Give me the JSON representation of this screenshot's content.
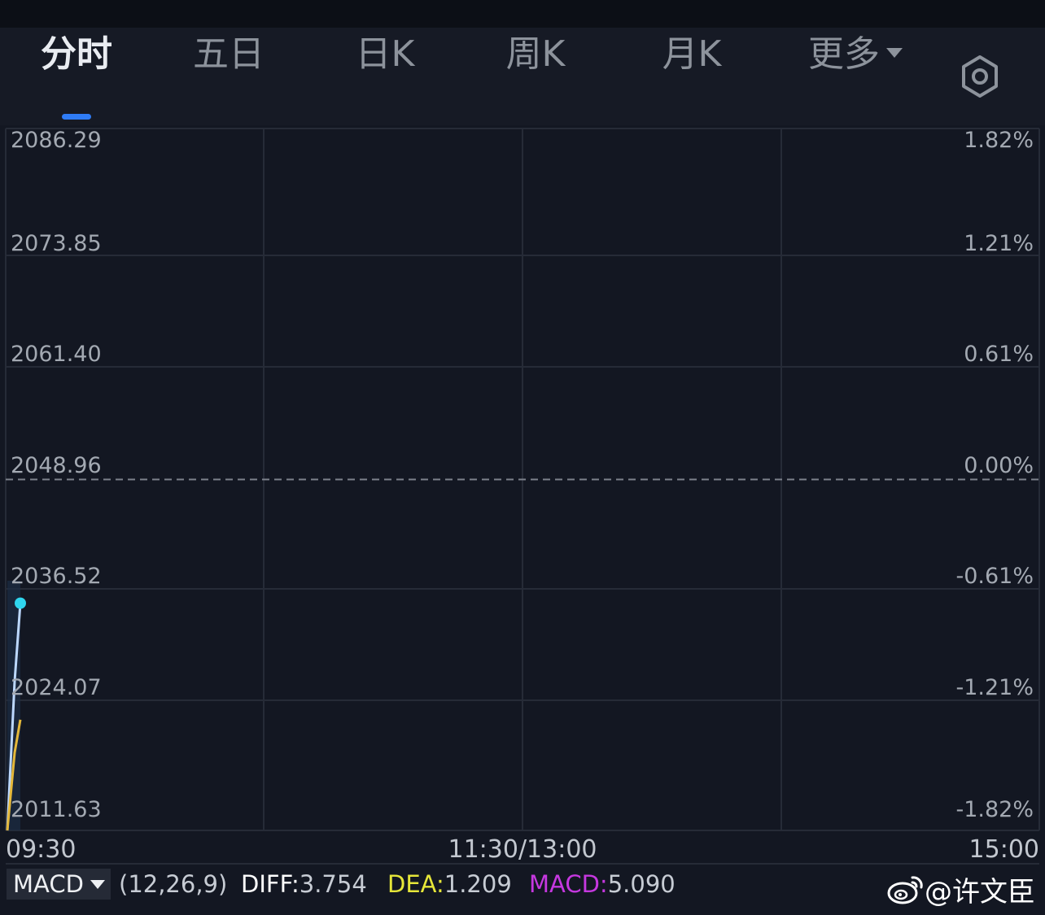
{
  "tabs": [
    {
      "label": "分时",
      "active": true
    },
    {
      "label": "五日",
      "active": false
    },
    {
      "label": "日K",
      "active": false
    },
    {
      "label": "周K",
      "active": false
    },
    {
      "label": "月K",
      "active": false
    },
    {
      "label": "更多",
      "active": false,
      "has_dropdown": true
    }
  ],
  "settings_icon": "hexagon-gear-icon",
  "colors": {
    "background": "#131722",
    "active_tab_underline": "#2f7cf6",
    "price_line": "#bcd8ff",
    "avg_line": "#e4b83a",
    "last_point": "#2fd5ee",
    "diff": "#ffffff",
    "dea": "#e6e639",
    "macd": "#c638e0"
  },
  "chart_data": {
    "type": "line",
    "y_left_labels": [
      "2086.29",
      "2073.85",
      "2061.40",
      "2048.96",
      "2036.52",
      "2024.07",
      "2011.63"
    ],
    "y_right_labels": [
      "1.82%",
      "1.21%",
      "0.61%",
      "0.00%",
      "-0.61%",
      "-1.21%",
      "-1.82%"
    ],
    "ylim": [
      2011.63,
      2086.29
    ],
    "reference_price": 2048.96,
    "x_labels": [
      "09:30",
      "11:30/13:00",
      "15:00"
    ],
    "grid": true,
    "series": [
      {
        "values": [
          2011.63,
          2027.5,
          2035.8
        ]
      },
      {
        "values": [
          2011.63,
          2019.9,
          2023.4
        ]
      }
    ]
  },
  "macd": {
    "selector_label": "MACD",
    "params": "(12,26,9)",
    "diff_label": "DIFF:",
    "diff_value": "3.754",
    "dea_label": "DEA:",
    "dea_value": "1.209",
    "macd_label": "MACD:",
    "macd_value": "5.090"
  },
  "watermark": {
    "text": "@许文臣",
    "icon": "weibo-logo-icon"
  }
}
